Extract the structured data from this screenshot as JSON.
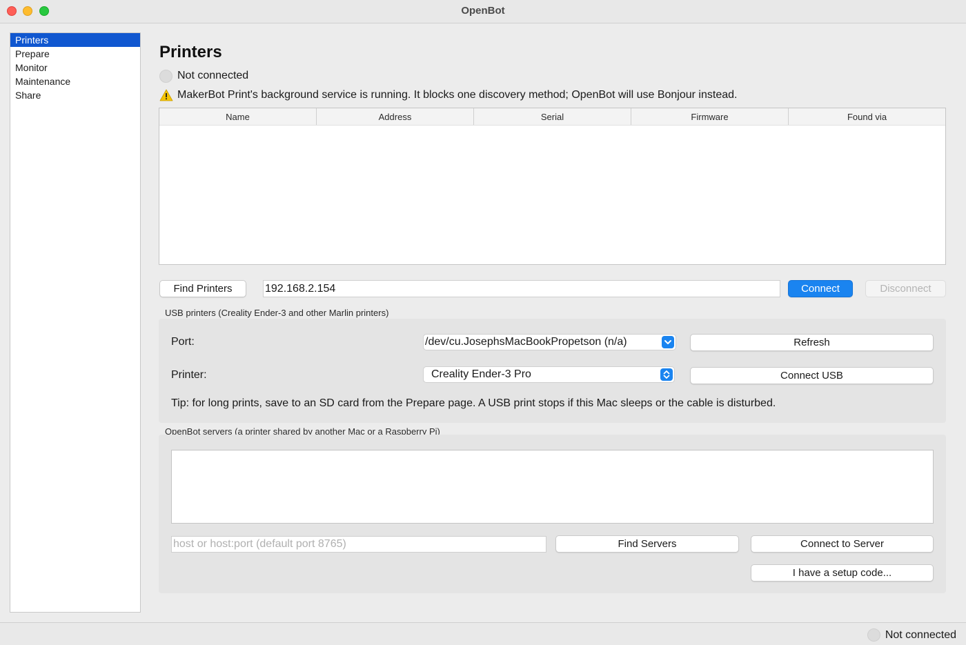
{
  "window": {
    "title": "OpenBot"
  },
  "sidebar": {
    "items": [
      {
        "label": "Printers",
        "selected": true
      },
      {
        "label": "Prepare"
      },
      {
        "label": "Monitor"
      },
      {
        "label": "Maintenance"
      },
      {
        "label": "Share"
      }
    ]
  },
  "main": {
    "title": "Printers",
    "status": "Not connected",
    "warning": "MakerBot Print's background service is running. It blocks one discovery method; OpenBot will use Bonjour instead.",
    "table": {
      "columns": [
        "Name",
        "Address",
        "Serial",
        "Firmware",
        "Found via"
      ],
      "rows": []
    },
    "find_printers_label": "Find Printers",
    "address_value": "192.168.2.154",
    "connect_label": "Connect",
    "disconnect_label": "Disconnect"
  },
  "usb": {
    "group_label": "USB printers (Creality Ender-3 and other Marlin printers)",
    "port_label": "Port:",
    "port_value": "/dev/cu.JosephsMacBookPropetson  (n/a)",
    "refresh_label": "Refresh",
    "printer_label": "Printer:",
    "printer_value": "Creality Ender-3 Pro",
    "connect_usb_label": "Connect USB",
    "tip": "Tip: for long prints, save to an SD card from the Prepare page. A USB print stops if this Mac sleeps or the cable is disturbed."
  },
  "servers": {
    "group_label": "OpenBot servers (a printer shared by another Mac or a Raspberry Pi)",
    "host_placeholder": "host or host:port (default port 8765)",
    "host_value": "",
    "find_servers_label": "Find Servers",
    "connect_server_label": "Connect to Server",
    "setup_code_label": "I have a setup code..."
  },
  "footer": {
    "status": "Not connected"
  },
  "colors": {
    "accent": "#1a84f0",
    "selection": "#1057d0",
    "warning": "#f5c400"
  },
  "icons": {
    "warning": "warning-triangle-icon",
    "status": "status-indicator-icon"
  }
}
